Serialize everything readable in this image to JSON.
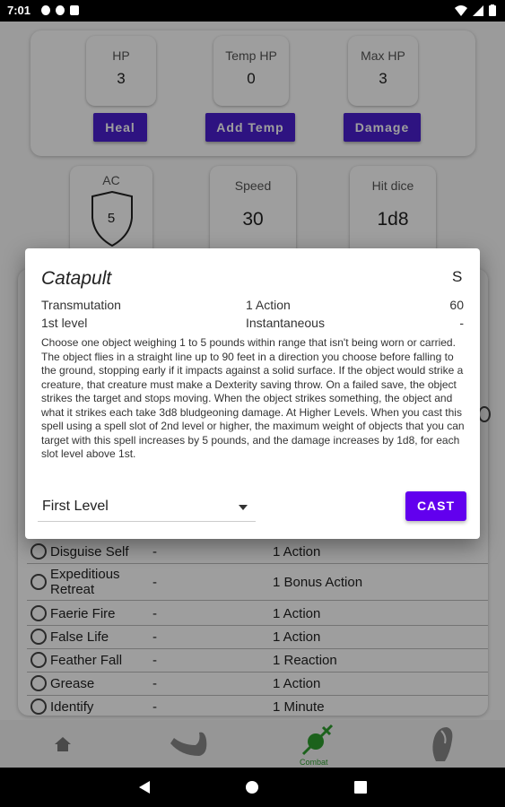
{
  "status_bar": {
    "time": "7:01"
  },
  "hp_section": {
    "hp": {
      "label": "HP",
      "value": "3"
    },
    "temp_hp": {
      "label": "Temp HP",
      "value": "0"
    },
    "max_hp": {
      "label": "Max HP",
      "value": "3"
    },
    "buttons": {
      "heal": "Heal",
      "add_temp": "Add Temp",
      "damage": "Damage"
    }
  },
  "stats": {
    "ac": {
      "label": "AC",
      "value": "5"
    },
    "speed": {
      "label": "Speed",
      "value": "30"
    },
    "hit_dice": {
      "label": "Hit dice",
      "value": "1d8"
    }
  },
  "spell_list": [
    {
      "name": "Disguise Self",
      "dash": "-",
      "time": "1 Action"
    },
    {
      "name": "Expeditious Retreat",
      "dash": "-",
      "time": "1 Bonus Action"
    },
    {
      "name": "Faerie Fire",
      "dash": "-",
      "time": "1 Action"
    },
    {
      "name": "False Life",
      "dash": "-",
      "time": "1 Action"
    },
    {
      "name": "Feather Fall",
      "dash": "-",
      "time": "1 Reaction"
    },
    {
      "name": "Grease",
      "dash": "-",
      "time": "1 Action"
    },
    {
      "name": "Identify",
      "dash": "-",
      "time": "1 Minute"
    }
  ],
  "bottom_nav": {
    "combat_label": "Combat"
  },
  "dialog": {
    "title": "Catapult",
    "components": "S",
    "school": "Transmutation",
    "casting_time": "1 Action",
    "range": "60",
    "level": "1st level",
    "duration": "Instantaneous",
    "extra": "-",
    "description": "Choose one object weighing 1 to 5 pounds within range that isn't being worn or carried. The object flies in a straight line up to 90 feet in a direction you choose before falling to the ground, stopping early if it impacts against a solid surface. If the object would strike a creature, that creature must make a Dexterity saving throw. On a failed save, the object strikes the target and stops moving. When the object strikes something, the object and what it strikes each take 3d8 bludgeoning damage. At Higher Levels. When you cast this spell using a spell slot of 2nd level or higher, the maximum weight of objects that you can target with this spell increases by 5 pounds, and the damage increases by 1d8, for each slot level above 1st.",
    "level_select": "First Level",
    "cast_label": "CAST"
  },
  "colors": {
    "primary": "#6200ee",
    "button_dark": "#4b1fd1",
    "combat_green": "#2e9e2e"
  }
}
